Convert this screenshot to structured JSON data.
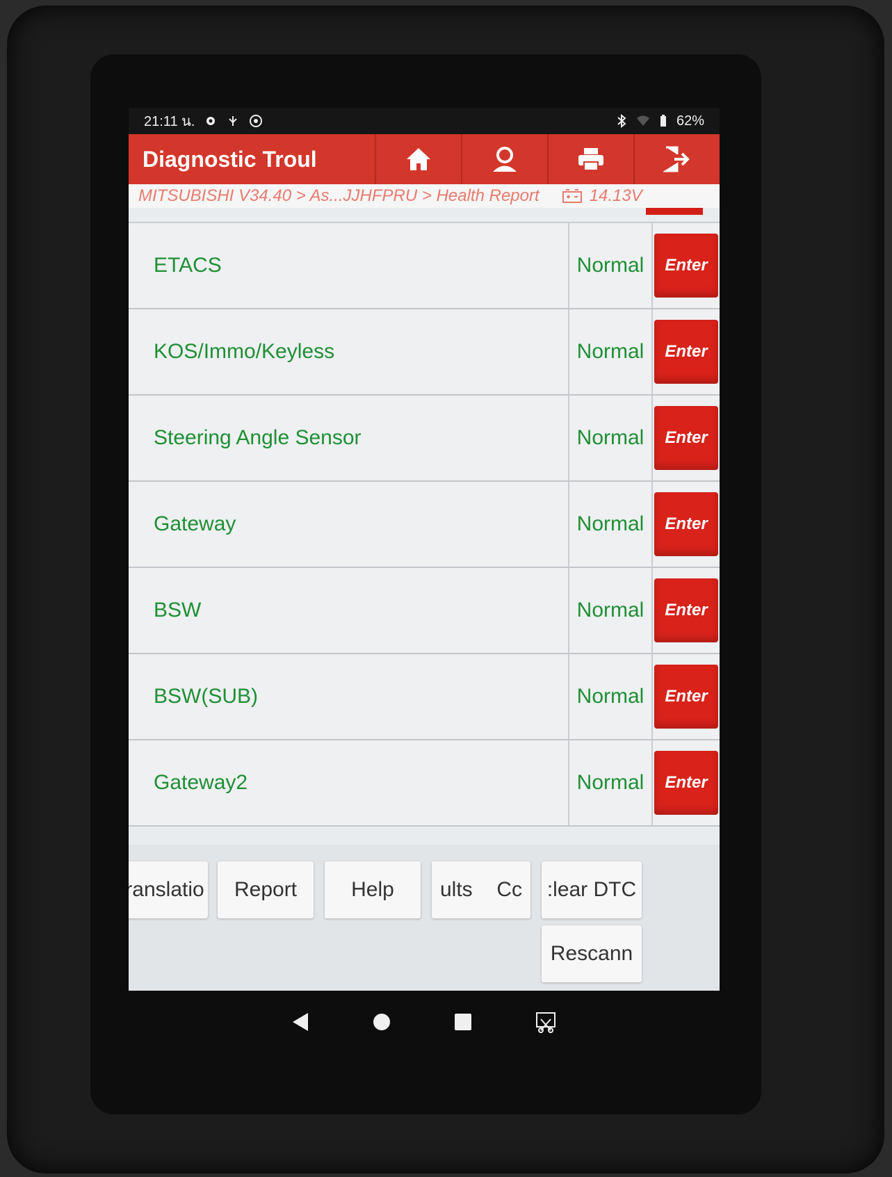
{
  "status_bar": {
    "time": "21:11 น.",
    "battery": "62%"
  },
  "header": {
    "title": "Diagnostic Troul",
    "icons": [
      "home-icon",
      "user-icon",
      "print-icon",
      "exit-icon"
    ]
  },
  "breadcrumb": {
    "path": "MITSUBISHI V34.40 > As...JJHFPRU > Health Report",
    "voltage": "14.13V"
  },
  "systems": [
    {
      "name": "ETACS",
      "status": "Normal",
      "action": "Enter"
    },
    {
      "name": "KOS/Immo/Keyless",
      "status": "Normal",
      "action": "Enter"
    },
    {
      "name": "Steering Angle Sensor",
      "status": "Normal",
      "action": "Enter"
    },
    {
      "name": "Gateway",
      "status": "Normal",
      "action": "Enter"
    },
    {
      "name": "BSW",
      "status": "Normal",
      "action": "Enter"
    },
    {
      "name": "BSW(SUB)",
      "status": "Normal",
      "action": "Enter"
    },
    {
      "name": "Gateway2",
      "status": "Normal",
      "action": "Enter"
    }
  ],
  "toolbar": {
    "translation": "ranslatio",
    "report": "Report",
    "help": "Help",
    "results": "ults",
    "results_suffix": "Cc",
    "clear_dtc": ":lear DTC",
    "rescan": "Rescann"
  },
  "colors": {
    "header_red": "#d3362a",
    "enter_red": "#d8221a",
    "status_green": "#1f8f34"
  }
}
